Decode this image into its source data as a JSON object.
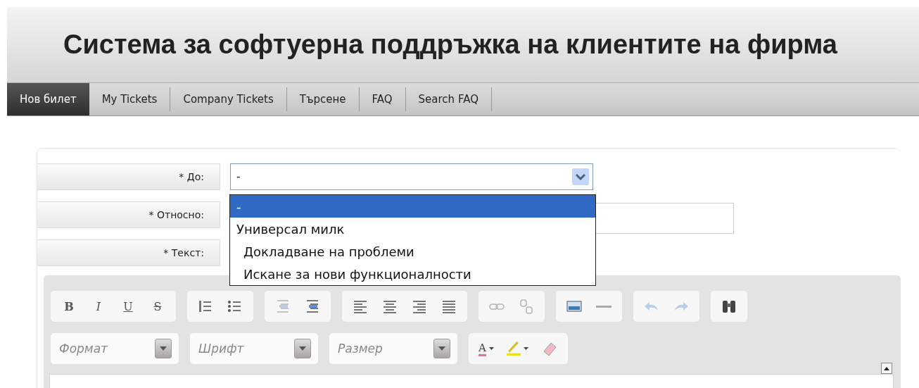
{
  "header": {
    "title": "Система за софтуерна поддръжка на клиентите на фирма"
  },
  "tabs": [
    {
      "label": "Нов билет",
      "selected": true
    },
    {
      "label": "My Tickets",
      "selected": false
    },
    {
      "label": "Company Tickets",
      "selected": false
    },
    {
      "label": "Търсене",
      "selected": false
    },
    {
      "label": "FAQ",
      "selected": false
    },
    {
      "label": "Search FAQ",
      "selected": false
    }
  ],
  "form": {
    "fields": [
      {
        "kind": "select",
        "label": "* До:",
        "value": "-",
        "expanded": true
      },
      {
        "kind": "text",
        "label": "* Относно:"
      },
      {
        "kind": "editor",
        "label": "* Текст:"
      }
    ],
    "dropdown_options": [
      {
        "label": "-",
        "selected": true
      },
      {
        "label": "Универсал милк",
        "selected": false,
        "children": [
          {
            "label": "Докладване на проблеми",
            "selected": false
          },
          {
            "label": "Искане за нови функционалности",
            "selected": false
          }
        ]
      }
    ]
  },
  "editor_toolbar": {
    "rows": [
      [
        [
          {
            "kind": "letter",
            "label": "B",
            "disabled": false
          },
          {
            "kind": "letter",
            "label": "I",
            "disabled": false
          },
          {
            "kind": "letter",
            "label": "U",
            "disabled": false
          },
          {
            "kind": "letter",
            "label": "S",
            "disabled": false
          }
        ],
        [
          {
            "kind": "icon",
            "disabled": false
          },
          {
            "kind": "icon",
            "disabled": false
          }
        ],
        [
          {
            "kind": "icon",
            "disabled": true
          },
          {
            "kind": "icon",
            "disabled": false
          }
        ],
        [
          {
            "kind": "icon",
            "disabled": false
          },
          {
            "kind": "icon",
            "disabled": false
          },
          {
            "kind": "icon",
            "disabled": false
          },
          {
            "kind": "icon",
            "disabled": false
          }
        ],
        [
          {
            "kind": "icon",
            "disabled": true
          },
          {
            "kind": "icon",
            "disabled": true
          }
        ],
        [
          {
            "kind": "icon",
            "disabled": false
          },
          {
            "kind": "icon",
            "disabled": false
          }
        ],
        [
          {
            "kind": "icon",
            "disabled": true
          },
          {
            "kind": "icon",
            "disabled": true
          }
        ],
        [
          {
            "kind": "icon",
            "disabled": false
          }
        ]
      ],
      [
        [
          {
            "kind": "combo",
            "placeholder": "Формат"
          }
        ],
        [
          {
            "kind": "combo",
            "placeholder": "Шрифт"
          }
        ],
        [
          {
            "kind": "combo",
            "placeholder": "Размер"
          }
        ],
        [
          {
            "kind": "color",
            "label": "A",
            "color": "#f07090",
            "disabled": false
          },
          {
            "kind": "highlight",
            "color": "#e8e020",
            "disabled": false
          },
          {
            "kind": "icon",
            "disabled": false
          }
        ]
      ]
    ]
  }
}
